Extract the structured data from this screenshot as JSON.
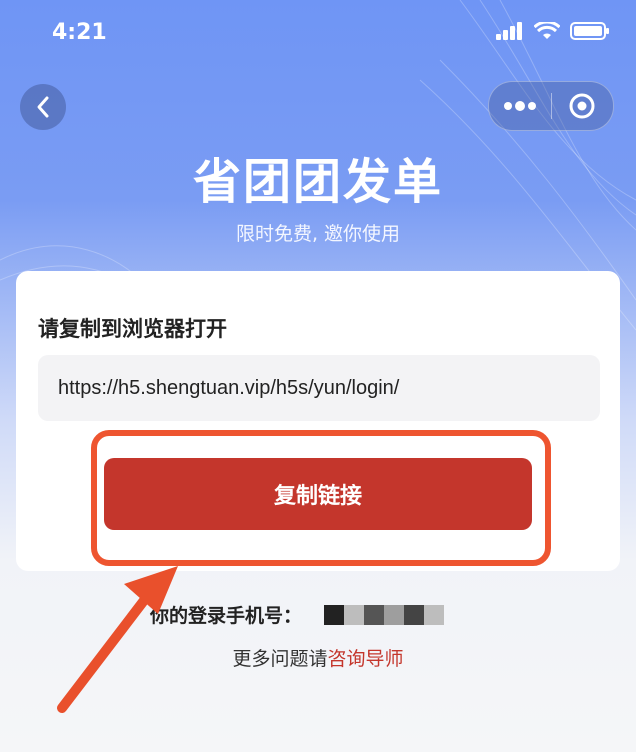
{
  "status_bar": {
    "time": "4:21"
  },
  "header": {
    "title": "省团团发单",
    "subtitle": "限时免费, 邀你使用"
  },
  "card": {
    "heading": "请复制到浏览器打开",
    "url": "https://h5.shengtuan.vip/h5s/yun/login/",
    "copy_button_label": "复制链接"
  },
  "phone": {
    "label": "你的登录手机号：",
    "masked_colors": [
      "#222222",
      "#bdbdbd",
      "#555555",
      "#9e9e9e",
      "#444444",
      "#bdbdbd"
    ]
  },
  "help": {
    "prefix": "更多问题请",
    "link": "咨询导师"
  },
  "colors": {
    "primary_red": "#c4362c",
    "highlight_orange": "#ee5530",
    "header_blue": "#6f95f5"
  }
}
